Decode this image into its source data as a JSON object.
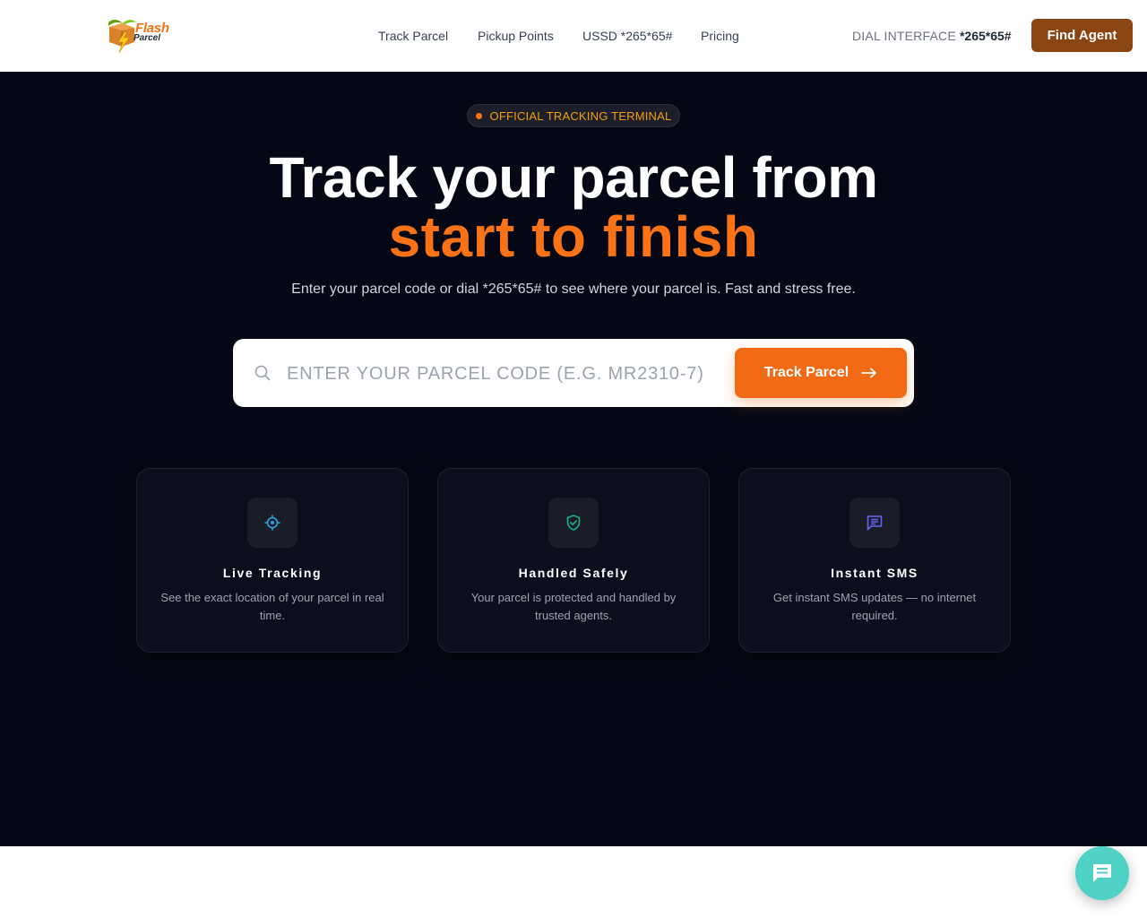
{
  "header": {
    "logo": {
      "line1": "Flash",
      "line2": "Parcel"
    },
    "nav": [
      {
        "label": "Track Parcel"
      },
      {
        "label": "Pickup Points"
      },
      {
        "label": "USSD *265*65#"
      },
      {
        "label": "Pricing"
      }
    ],
    "dial_label": "DIAL INTERFACE",
    "dial_code": "*265*65#",
    "cta_label": "Find Agent"
  },
  "hero": {
    "badge": "OFFICIAL TRACKING TERMINAL",
    "title_line1": "Track your parcel from",
    "title_line2": "start to finish",
    "subtitle": "Enter your parcel code or dial *265*65# to see where your parcel is. Fast and stress free.",
    "search": {
      "placeholder": "ENTER YOUR PARCEL CODE (E.G. MR2310-7)",
      "value": "",
      "button_label": "Track Parcel"
    }
  },
  "features": [
    {
      "icon": "target-icon",
      "title": "Live Tracking",
      "description": "See the exact location of your parcel in real time."
    },
    {
      "icon": "shield-check-icon",
      "title": "Handled Safely",
      "description": "Your parcel is protected and handled by trusted agents."
    },
    {
      "icon": "message-icon",
      "title": "Instant SMS",
      "description": "Get instant SMS updates — no internet required."
    }
  ],
  "chat": {
    "icon": "chat-icon"
  },
  "colors": {
    "accent": "#f97316",
    "brand_brown": "#8b4513",
    "hero_bg": "#050814",
    "chat": "#4fd1c5"
  }
}
